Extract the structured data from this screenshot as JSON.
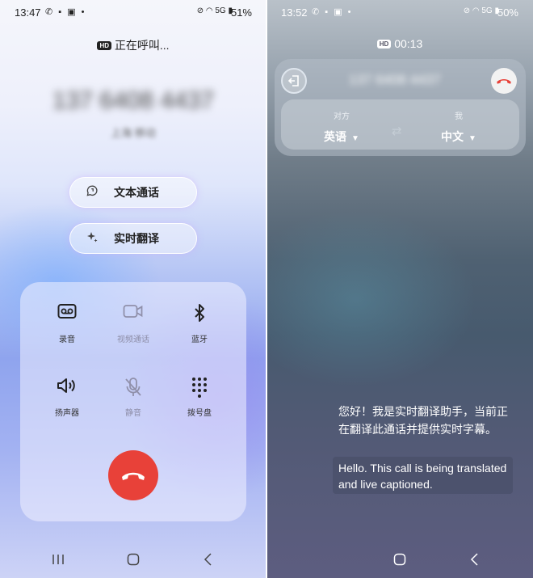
{
  "left": {
    "status_bar": {
      "time": "13:47",
      "battery": "51%",
      "network": "5G"
    },
    "hd": "HD",
    "call_status": "正在呼叫...",
    "number": "137 6408 4437",
    "location": "上海 移动",
    "pills": [
      {
        "icon": "chat-bubble-icon",
        "label": "文本通话"
      },
      {
        "icon": "sparkle-icon",
        "label": "实时翻译"
      }
    ],
    "controls": [
      {
        "name": "record",
        "icon": "voicemail-icon",
        "label": "录音",
        "enabled": true
      },
      {
        "name": "video-call",
        "icon": "video-camera-icon",
        "label": "视频通话",
        "enabled": false
      },
      {
        "name": "bluetooth",
        "icon": "bluetooth-icon",
        "label": "蓝牙",
        "enabled": true
      },
      {
        "name": "speaker",
        "icon": "speaker-icon",
        "label": "扬声器",
        "enabled": true
      },
      {
        "name": "mute",
        "icon": "mic-off-icon",
        "label": "静音",
        "enabled": false
      },
      {
        "name": "keypad",
        "icon": "dialpad-icon",
        "label": "拨号盘",
        "enabled": true
      }
    ],
    "end_call_color": "#e84139"
  },
  "right": {
    "status_bar": {
      "time": "13:52",
      "battery": "50%",
      "network": "5G"
    },
    "hd": "HD",
    "timer": "00:13",
    "remote_number": "137 6408 4437",
    "other_party_caption": "对方",
    "other_party_lang": "英语",
    "me_caption": "我",
    "me_lang": "中文",
    "caption_zh": "您好！我是实时翻译助手，当前正在翻译此通话并提供实时字幕。",
    "caption_en": "Hello. This call is being translated and live captioned.",
    "page_count": 2,
    "active_page": 2
  }
}
